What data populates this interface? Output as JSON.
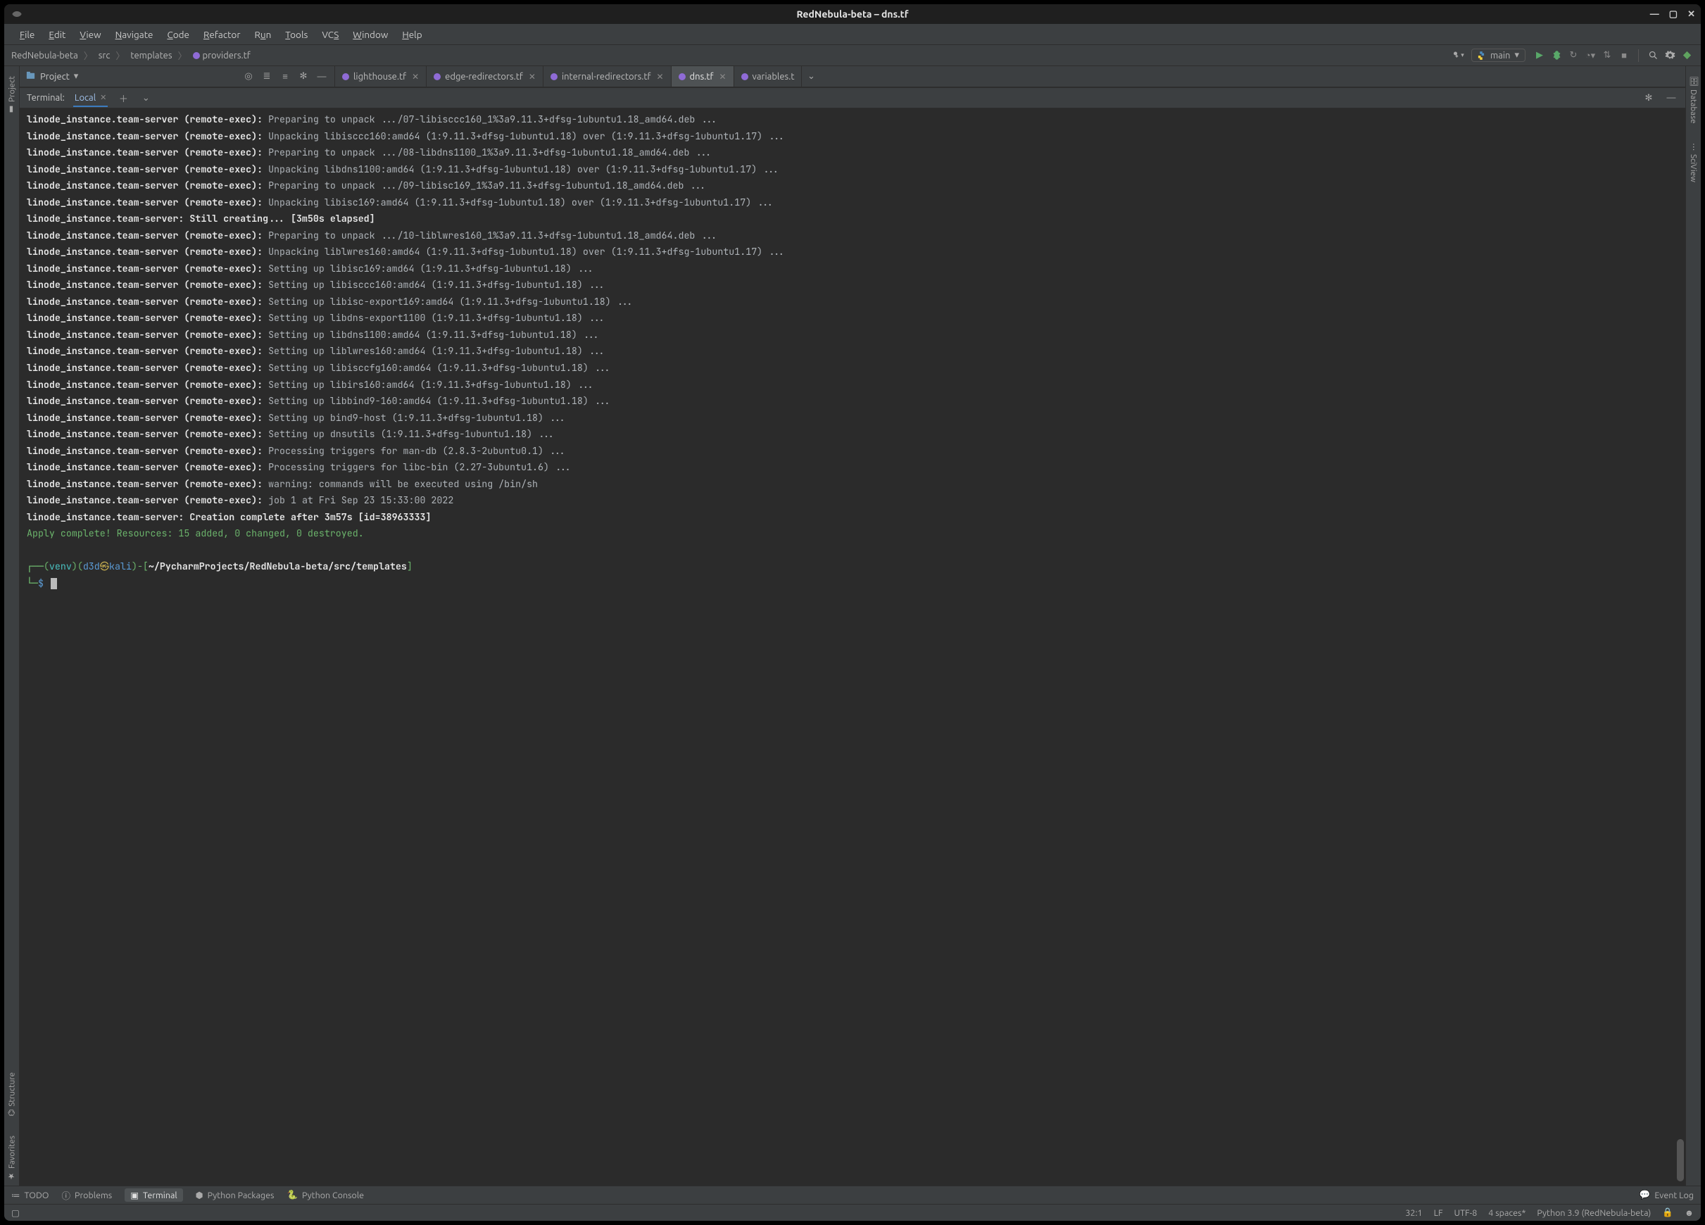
{
  "window": {
    "title": "RedNebula-beta – dns.tf"
  },
  "menu": {
    "file": "File",
    "edit": "Edit",
    "view": "View",
    "navigate": "Navigate",
    "code": "Code",
    "refactor": "Refactor",
    "run": "Run",
    "tools": "Tools",
    "vcs": "VCS",
    "window": "Window",
    "help": "Help"
  },
  "breadcrumbs": {
    "root": "RedNebula-beta",
    "p1": "src",
    "p2": "templates",
    "file": "providers.tf"
  },
  "run_config": {
    "name": "main"
  },
  "project": {
    "label": "Project"
  },
  "editor_tabs": [
    {
      "name": "lighthouse.tf",
      "active": false
    },
    {
      "name": "edge-redirectors.tf",
      "active": false
    },
    {
      "name": "internal-redirectors.tf",
      "active": false
    },
    {
      "name": "dns.tf",
      "active": true
    },
    {
      "name": "variables.t",
      "active": false,
      "truncated": true
    }
  ],
  "terminal": {
    "title": "Terminal:",
    "tab": "Local",
    "lines": [
      {
        "prefix": "linode_instance.team-server (remote-exec):",
        "body": " Preparing to unpack .../07-libisccc160_1%3a9.11.3+dfsg-1ubuntu1.18_amd64.deb ..."
      },
      {
        "prefix": "linode_instance.team-server (remote-exec):",
        "body": " Unpacking libisccc160:amd64 (1:9.11.3+dfsg-1ubuntu1.18) over (1:9.11.3+dfsg-1ubuntu1.17) ..."
      },
      {
        "prefix": "linode_instance.team-server (remote-exec):",
        "body": " Preparing to unpack .../08-libdns1100_1%3a9.11.3+dfsg-1ubuntu1.18_amd64.deb ..."
      },
      {
        "prefix": "linode_instance.team-server (remote-exec):",
        "body": " Unpacking libdns1100:amd64 (1:9.11.3+dfsg-1ubuntu1.18) over (1:9.11.3+dfsg-1ubuntu1.17) ..."
      },
      {
        "prefix": "linode_instance.team-server (remote-exec):",
        "body": " Preparing to unpack .../09-libisc169_1%3a9.11.3+dfsg-1ubuntu1.18_amd64.deb ..."
      },
      {
        "prefix": "linode_instance.team-server (remote-exec):",
        "body": " Unpacking libisc169:amd64 (1:9.11.3+dfsg-1ubuntu1.18) over (1:9.11.3+dfsg-1ubuntu1.17) ..."
      },
      {
        "prefix": "linode_instance.team-server: Still creating... [3m50s elapsed]",
        "body": ""
      },
      {
        "prefix": "linode_instance.team-server (remote-exec):",
        "body": " Preparing to unpack .../10-liblwres160_1%3a9.11.3+dfsg-1ubuntu1.18_amd64.deb ..."
      },
      {
        "prefix": "linode_instance.team-server (remote-exec):",
        "body": " Unpacking liblwres160:amd64 (1:9.11.3+dfsg-1ubuntu1.18) over (1:9.11.3+dfsg-1ubuntu1.17) ..."
      },
      {
        "prefix": "linode_instance.team-server (remote-exec):",
        "body": " Setting up libisc169:amd64 (1:9.11.3+dfsg-1ubuntu1.18) ..."
      },
      {
        "prefix": "linode_instance.team-server (remote-exec):",
        "body": " Setting up libisccc160:amd64 (1:9.11.3+dfsg-1ubuntu1.18) ..."
      },
      {
        "prefix": "linode_instance.team-server (remote-exec):",
        "body": " Setting up libisc-export169:amd64 (1:9.11.3+dfsg-1ubuntu1.18) ..."
      },
      {
        "prefix": "linode_instance.team-server (remote-exec):",
        "body": " Setting up libdns-export1100 (1:9.11.3+dfsg-1ubuntu1.18) ..."
      },
      {
        "prefix": "linode_instance.team-server (remote-exec):",
        "body": " Setting up libdns1100:amd64 (1:9.11.3+dfsg-1ubuntu1.18) ..."
      },
      {
        "prefix": "linode_instance.team-server (remote-exec):",
        "body": " Setting up liblwres160:amd64 (1:9.11.3+dfsg-1ubuntu1.18) ..."
      },
      {
        "prefix": "linode_instance.team-server (remote-exec):",
        "body": " Setting up libisccfg160:amd64 (1:9.11.3+dfsg-1ubuntu1.18) ..."
      },
      {
        "prefix": "linode_instance.team-server (remote-exec):",
        "body": " Setting up libirs160:amd64 (1:9.11.3+dfsg-1ubuntu1.18) ..."
      },
      {
        "prefix": "linode_instance.team-server (remote-exec):",
        "body": " Setting up libbind9-160:amd64 (1:9.11.3+dfsg-1ubuntu1.18) ..."
      },
      {
        "prefix": "linode_instance.team-server (remote-exec):",
        "body": " Setting up bind9-host (1:9.11.3+dfsg-1ubuntu1.18) ..."
      },
      {
        "prefix": "linode_instance.team-server (remote-exec):",
        "body": " Setting up dnsutils (1:9.11.3+dfsg-1ubuntu1.18) ..."
      },
      {
        "prefix": "linode_instance.team-server (remote-exec):",
        "body": " Processing triggers for man-db (2.8.3-2ubuntu0.1) ..."
      },
      {
        "prefix": "linode_instance.team-server (remote-exec):",
        "body": " Processing triggers for libc-bin (2.27-3ubuntu1.6) ..."
      },
      {
        "prefix": "linode_instance.team-server (remote-exec):",
        "body": " warning: commands will be executed using /bin/sh"
      },
      {
        "prefix": "linode_instance.team-server (remote-exec):",
        "body": " job 1 at Fri Sep 23 15:33:00 2022"
      },
      {
        "prefix": "linode_instance.team-server: Creation complete after 3m57s [id=38963333]",
        "body": ""
      }
    ],
    "apply_line": "Apply complete! Resources: 15 added, 0 changed, 0 destroyed.",
    "prompt": {
      "venv": "venv",
      "user": "d3d",
      "host": "kali",
      "path": "~/PycharmProjects/RedNebula-beta/src/templates"
    }
  },
  "left_tabs": {
    "project": "Project",
    "structure": "Structure",
    "favorites": "Favorites"
  },
  "right_tabs": {
    "database": "Database",
    "sciview": "SciView"
  },
  "bottom_tools": {
    "todo": "TODO",
    "problems": "Problems",
    "terminal": "Terminal",
    "packages": "Python Packages",
    "console": "Python Console",
    "eventlog": "Event Log"
  },
  "status": {
    "pos": "32:1",
    "lineend": "LF",
    "encoding": "UTF-8",
    "indent": "4 spaces*",
    "interpreter": "Python 3.9 (RedNebula-beta)"
  }
}
